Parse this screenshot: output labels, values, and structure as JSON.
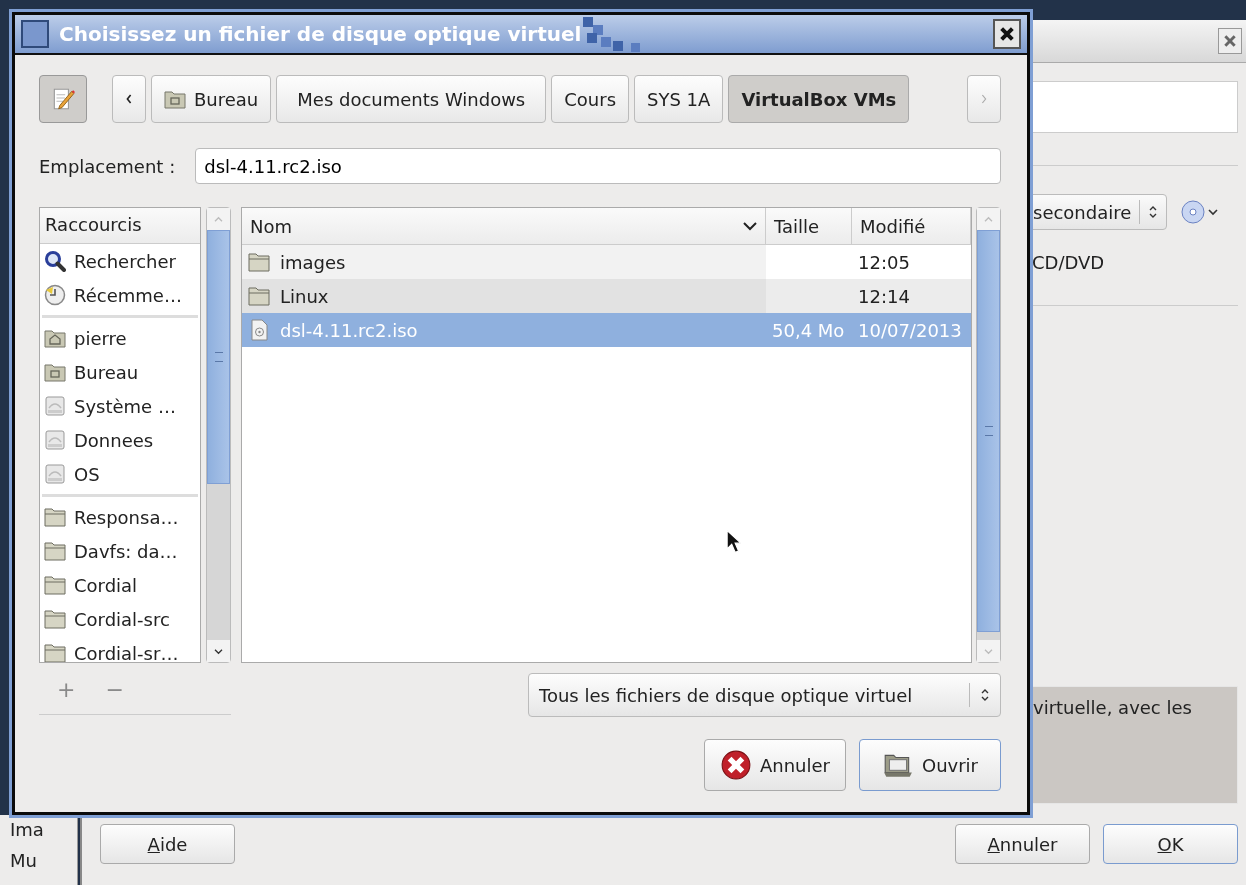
{
  "background_window": {
    "left_list": [
      "Ima",
      "Mu"
    ],
    "combo": {
      "value": "secondaire"
    },
    "media_label": "CD/DVD",
    "info_text": "virtuelle, avec les",
    "buttons": [
      {
        "label": "Aide",
        "underline_first": true,
        "default": false
      },
      {
        "label": "Annuler",
        "underline_first": true,
        "default": false
      },
      {
        "label": "OK",
        "underline_first": true,
        "default": true
      }
    ]
  },
  "dialog": {
    "title": "Choisissez un fichier de disque optique virtuel",
    "path_bar": [
      {
        "label": "Bureau",
        "kind": "desktop",
        "selected": false
      },
      {
        "label": "Mes documents Windows",
        "kind": "plain",
        "selected": false
      },
      {
        "label": "Cours",
        "kind": "plain",
        "selected": false
      },
      {
        "label": "SYS 1A",
        "kind": "plain",
        "selected": false
      },
      {
        "label": "VirtualBox VMs",
        "kind": "plain",
        "selected": true
      }
    ],
    "location": {
      "label": "Emplacement :",
      "value": "dsl-4.11.rc2.iso"
    },
    "sidebar": {
      "header": "Raccourcis",
      "sections": [
        {
          "items": [
            {
              "label": "Rechercher",
              "kind": "search"
            },
            {
              "label": "Récemme…",
              "kind": "recent"
            }
          ]
        },
        {
          "items": [
            {
              "label": "pierre",
              "kind": "home"
            },
            {
              "label": "Bureau",
              "kind": "desktop"
            },
            {
              "label": "Système …",
              "kind": "drive"
            },
            {
              "label": "Donnees",
              "kind": "drive"
            },
            {
              "label": "OS",
              "kind": "drive"
            }
          ]
        },
        {
          "items": [
            {
              "label": "Responsa…",
              "kind": "folder"
            },
            {
              "label": "Davfs: da…",
              "kind": "folder"
            },
            {
              "label": "Cordial",
              "kind": "folder"
            },
            {
              "label": "Cordial-src",
              "kind": "folder"
            },
            {
              "label": "Cordial-sr…",
              "kind": "folder"
            }
          ]
        }
      ]
    },
    "add_remove": [
      "+",
      "−"
    ],
    "files": {
      "columns": [
        "Nom",
        "Taille",
        "Modifié"
      ],
      "rows": [
        {
          "name": "images",
          "size": "",
          "modified": "12:05",
          "kind": "folder",
          "selected": false
        },
        {
          "name": "Linux",
          "size": "",
          "modified": "12:14",
          "kind": "folder",
          "selected": false
        },
        {
          "name": "dsl-4.11.rc2.iso",
          "size": "50,4 Mo",
          "modified": "10/07/2013",
          "kind": "file",
          "selected": true
        }
      ]
    },
    "filter": {
      "value": "Tous les fichiers de disque optique virtuel"
    },
    "buttons": [
      {
        "label": "Annuler",
        "kind": "cancel"
      },
      {
        "label": "Ouvrir",
        "kind": "open"
      }
    ]
  }
}
